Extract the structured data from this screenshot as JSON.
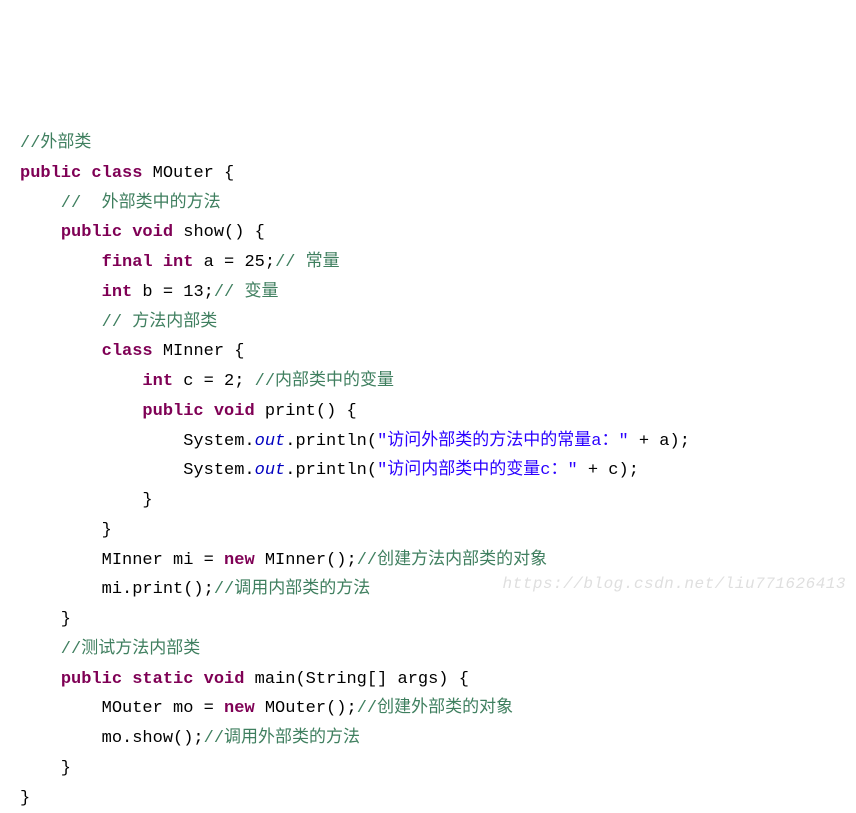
{
  "c1": "//外部类",
  "l2": {
    "p1": "public",
    "p2": "class",
    "p3": " MOuter {"
  },
  "c3": "    //  外部类中的方法",
  "l4": {
    "p1": "public",
    "p2": "void",
    "p3": " show() {"
  },
  "l5": {
    "p1": "final",
    "p2": "int",
    "p3": " a = 25;",
    "c": "// 常量"
  },
  "l6": {
    "p1": "int",
    "p2": " b = 13;",
    "c": "// 变量"
  },
  "c7": "        // 方法内部类",
  "l8": {
    "p1": "class",
    "p2": " MInner {"
  },
  "l9": {
    "p1": "int",
    "p2": " c = 2; ",
    "c": "//内部类中的变量"
  },
  "l10": {
    "p1": "public",
    "p2": "void",
    "p3": " print() {"
  },
  "l11": {
    "a": "                System.",
    "b": "out",
    "c": ".println(",
    "s": "\"访问外部类的方法中的常量a：\"",
    "d": " + a);"
  },
  "l12": {
    "a": "                System.",
    "b": "out",
    "c": ".println(",
    "s": "\"访问内部类中的变量c：\"",
    "d": " + c);"
  },
  "l13": "            }",
  "l14": "        }",
  "l15": {
    "a": "        MInner mi = ",
    "k": "new",
    "b": " MInner();",
    "c": "//创建方法内部类的对象"
  },
  "l16": {
    "a": "        mi.print();",
    "c": "//调用内部类的方法"
  },
  "l17": "    }",
  "c18": "    //测试方法内部类",
  "l19": {
    "p1": "public",
    "p2": "static",
    "p3": "void",
    "p4": " main(String[] args) {"
  },
  "l20": {
    "a": "        MOuter mo = ",
    "k": "new",
    "b": " MOuter();",
    "c": "//创建外部类的对象"
  },
  "l21": {
    "a": "        mo.show();",
    "c": "//调用外部类的方法"
  },
  "l22": "    }",
  "l23": "}",
  "watermark": "https://blog.csdn.net/liu771626413"
}
